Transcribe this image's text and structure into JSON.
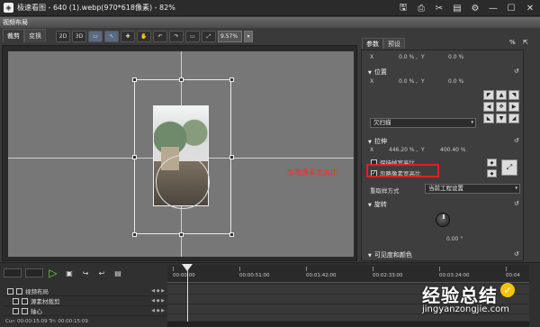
{
  "window": {
    "title": "极速看图 - 640 (1).webp(970*618像素) - 82%",
    "logo_glyph": "◈"
  },
  "titlebar_icons": [
    "save-icon",
    "print-icon",
    "cut-icon",
    "image-icon",
    "settings-icon",
    "minimize-icon",
    "maximize-icon",
    "close-icon"
  ],
  "titlebar_glyphs": [
    "🖫",
    "⎙",
    "✂",
    "▤",
    "⚙",
    "—",
    "☐",
    "✕"
  ],
  "panel_title": "视频布局",
  "left_tabs": [
    {
      "label": "裁剪",
      "active": true
    },
    {
      "label": "变换",
      "active": false
    }
  ],
  "toolbar": {
    "btn_2d": "2D",
    "btn_3d": "3D",
    "glyphs": [
      "▭",
      "↖",
      "✚",
      "✋",
      "↶",
      "↷",
      "▭",
      "⤢"
    ],
    "zoom_value": "9.57%",
    "zoom_arrow": "▾"
  },
  "annotation": "忽略像素宽高比",
  "right_panel": {
    "tabs": [
      {
        "label": "参数",
        "active": true
      },
      {
        "label": "预设",
        "active": false
      }
    ],
    "pct_icon": "%",
    "pin_icon": "⇱",
    "reset_glyph": "↺",
    "tri_glyph": "▼",
    "dropdown_arrow": "▾",
    "check_mark": "✓",
    "x_label": "X",
    "y_label": "Y",
    "top_x": "0.0 % ,",
    "top_y": "0.0 %",
    "position_label": "位置",
    "pos_x": "0.0 % ,",
    "pos_y": "0.0 %",
    "direction_buttons": [
      "◤",
      "▲",
      "◥",
      "◀",
      "✥",
      "▶",
      "◣",
      "▼",
      "◢"
    ],
    "overscan_select": "欠扫描",
    "scale_label": "拉伸",
    "scale_x": "446.20 % ,",
    "scale_y": "400.40 %",
    "keep_aspect_label": "保持帧宽高比",
    "keep_aspect_checked": false,
    "ignore_pixel_label": "忽略像素宽高比",
    "ignore_pixel_checked": true,
    "resample_label": "重取样方式",
    "resample_value": "当前工程设置",
    "fit_small_glyphs": [
      "◆",
      "◆"
    ],
    "fit_glyph": "⤢",
    "rotate_label": "旋转",
    "rotate_value": "0.00 °",
    "visibility_label": "可见度和颜色"
  },
  "timeline": {
    "play_glyph": "▷",
    "ctrl_glyphs": [
      "▣",
      "↪",
      "↩",
      "▤"
    ],
    "ruler_ticks": [
      "00:00:00",
      "00:00:51:00",
      "00:01:42:00",
      "00:02:33:00",
      "00:03:24:00",
      "00:04"
    ],
    "tracks": [
      {
        "label": "视频布局",
        "expanded": true
      },
      {
        "label": "源素材裁剪",
        "expanded": false
      },
      {
        "label": "轴心",
        "expanded": false
      }
    ],
    "track_ctrl": "◀ ◆ ▶",
    "timecode": "Cur: 00:00:15:09  Tri: 00:00:15:09"
  },
  "watermark": {
    "logo": "经验总结",
    "check": "✓",
    "url": "jingyanzongjie.com"
  }
}
